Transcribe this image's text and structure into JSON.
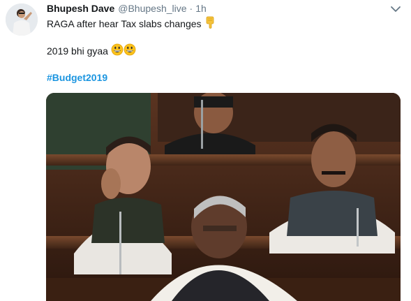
{
  "tweet": {
    "display_name": "Bhupesh Dave",
    "handle": "@Bhupesh_live",
    "separator": "·",
    "time": "1h",
    "line1": "RAGA after hear Tax slabs changes",
    "line1_emoji": "backhand-index-pointing-down",
    "line2": "2019 bhi gyaa",
    "line2_emoji": "grinning-face",
    "hashtag": "#Budget2019"
  },
  "colors": {
    "hashtag": "#1b95e0",
    "secondary_text": "#657786",
    "primary_text": "#14171a"
  },
  "icons": {
    "menu": "chevron-down-icon",
    "avatar": "user-avatar"
  }
}
